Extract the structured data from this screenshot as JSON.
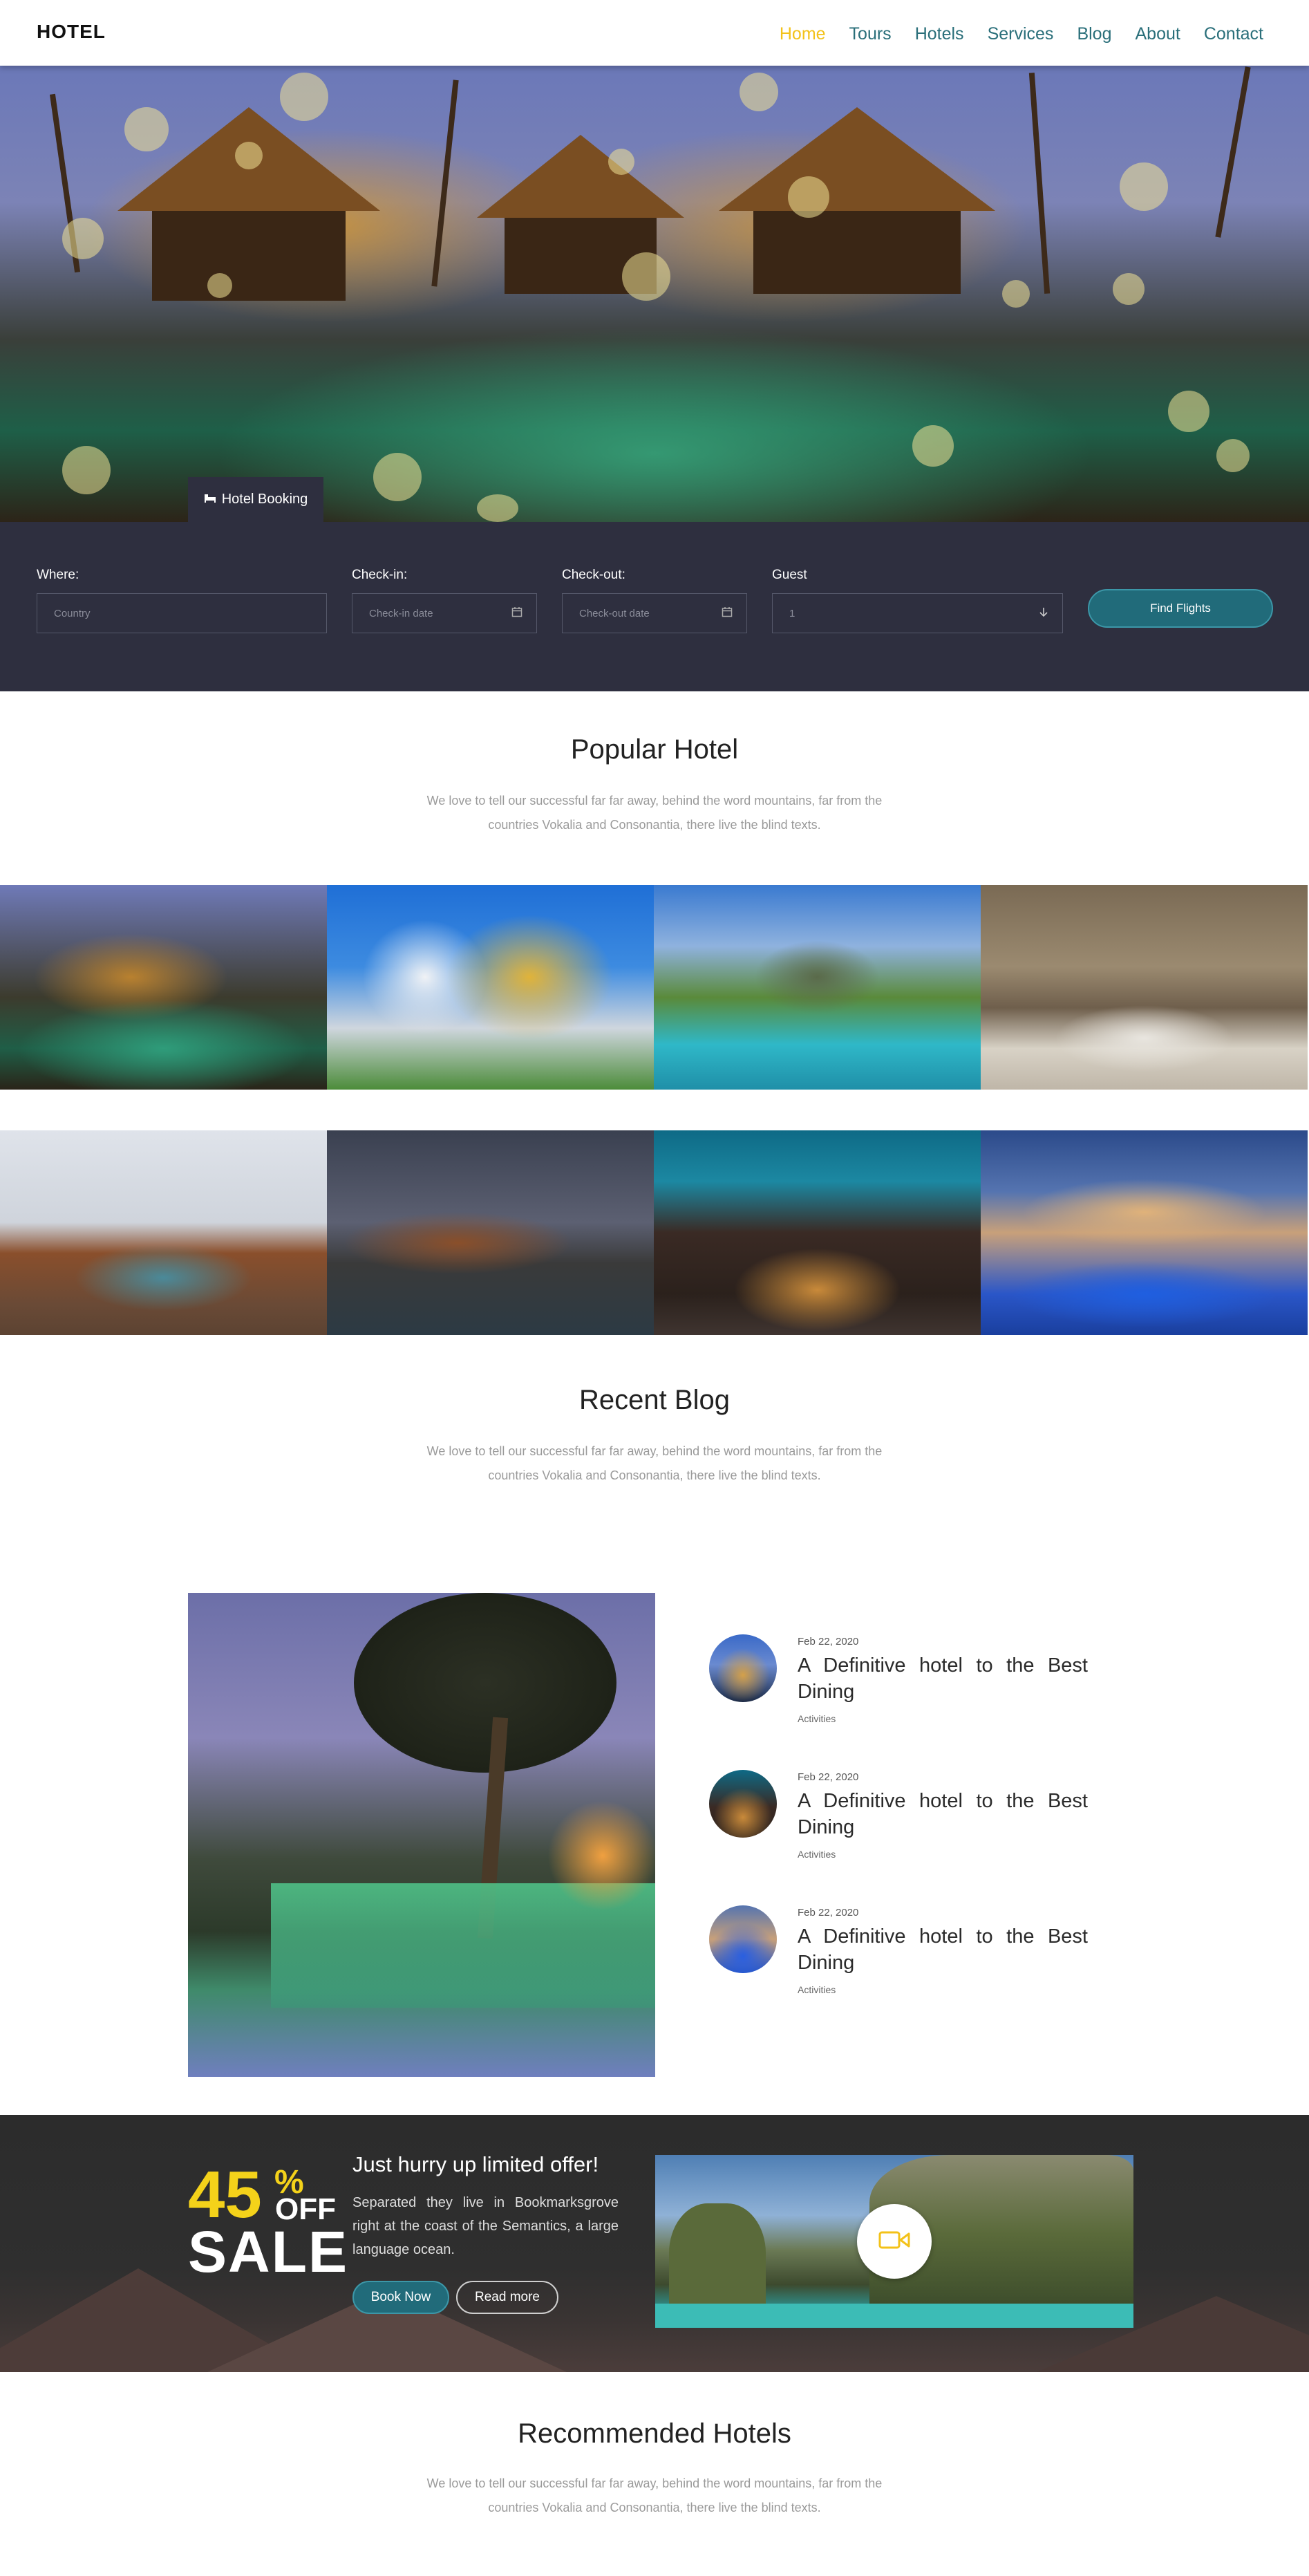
{
  "header": {
    "logo": "HOTEL",
    "nav": [
      {
        "label": "Home",
        "active": true
      },
      {
        "label": "Tours",
        "active": false
      },
      {
        "label": "Hotels",
        "active": false
      },
      {
        "label": "Services",
        "active": false
      },
      {
        "label": "Blog",
        "active": false
      },
      {
        "label": "About",
        "active": false
      },
      {
        "label": "Contact",
        "active": false
      }
    ]
  },
  "hero": {
    "booking_tab_icon": "bed-icon",
    "booking_tab_label": "Hotel Booking"
  },
  "search": {
    "where_label": "Where:",
    "where_placeholder": "Country",
    "checkin_label": "Check-in:",
    "checkin_placeholder": "Check-in date",
    "checkout_label": "Check-out:",
    "checkout_placeholder": "Check-out date",
    "guest_label": "Guest",
    "guest_value": "1",
    "button_label": "Find Flights",
    "icons": {
      "calendar": "calendar-icon",
      "dropdown": "arrow-down-icon"
    }
  },
  "popular": {
    "title": "Popular Hotel",
    "subtitle": "We love to tell our successful far far away, behind the word mountains, far from the countries Vokalia and Consonantia, there live the blind texts."
  },
  "recent_blog": {
    "title": "Recent Blog",
    "subtitle": "We love to tell our successful far far away, behind the word mountains, far from the countries Vokalia and Consonantia, there live the blind texts.",
    "posts": [
      {
        "date": "Feb 22, 2020",
        "title": "A Definitive hotel to the Best Dining",
        "category": "Activities"
      },
      {
        "date": "Feb 22, 2020",
        "title": "A Definitive hotel to the Best Dining",
        "category": "Activities"
      },
      {
        "date": "Feb 22, 2020",
        "title": "A Definitive hotel to the Best Dining",
        "category": "Activities"
      }
    ]
  },
  "offer": {
    "percent": "45",
    "percent_symbol": "%",
    "off": "OFF",
    "sale": "SALE",
    "title": "Just hurry up limited offer!",
    "text": "Separated they live in Bookmarksgrove right at the coast of the Semantics, a large language ocean.",
    "book_now": "Book Now",
    "read_more": "Read more",
    "video_icon": "video-camera-icon"
  },
  "recommended": {
    "title": "Recommended Hotels",
    "subtitle": "We love to tell our successful far far away, behind the word mountains, far from the countries Vokalia and Consonantia, there live the blind texts."
  },
  "colors": {
    "accent": "#f3c21a",
    "nav": "#2a6f7a",
    "panel": "#2e2f3f",
    "button": "#216b7a"
  }
}
